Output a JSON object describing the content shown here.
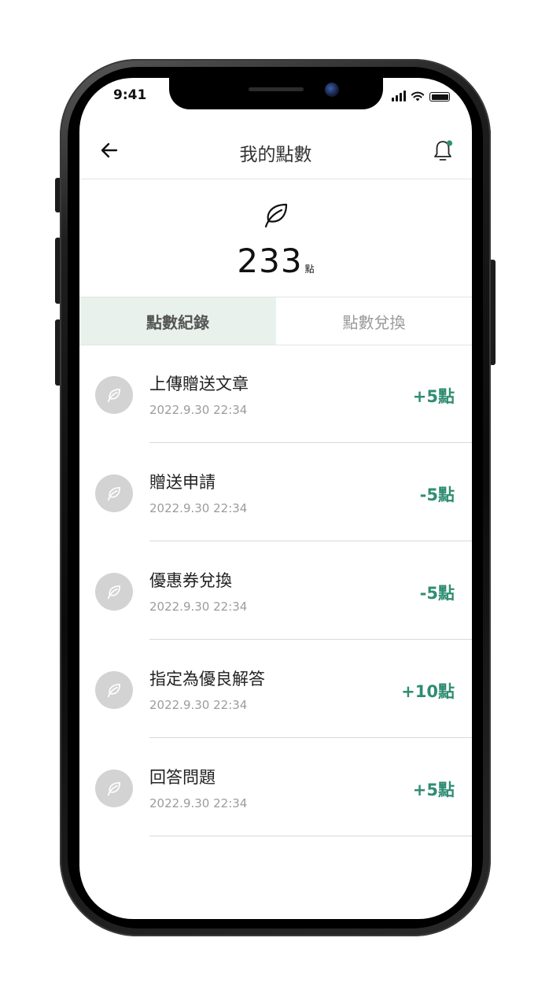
{
  "status_bar": {
    "time": "9:41"
  },
  "header": {
    "title": "我的點數"
  },
  "summary": {
    "points": "233",
    "unit": "點"
  },
  "tabs": [
    {
      "label": "點數紀錄",
      "active": true
    },
    {
      "label": "點數兌換",
      "active": false
    }
  ],
  "records": [
    {
      "title": "上傳贈送文章",
      "date": "2022.9.30 22:34",
      "points": "+5點"
    },
    {
      "title": "贈送申請",
      "date": "2022.9.30 22:34",
      "points": "-5點"
    },
    {
      "title": "優惠券兌換",
      "date": "2022.9.30 22:34",
      "points": "-5點"
    },
    {
      "title": "指定為優良解答",
      "date": "2022.9.30 22:34",
      "points": "+10點"
    },
    {
      "title": "回答問題",
      "date": "2022.9.30 22:34",
      "points": "+5點"
    }
  ],
  "icons": {
    "back": "arrow-left-icon",
    "notification": "bell-icon",
    "points": "leaf-icon",
    "record": "leaf-icon"
  },
  "colors": {
    "accent": "#2f8d72",
    "active_tab_bg": "#e9f1ed",
    "notification_dot": "#2f8d72",
    "record_icon_bg": "#d3d3d3"
  }
}
